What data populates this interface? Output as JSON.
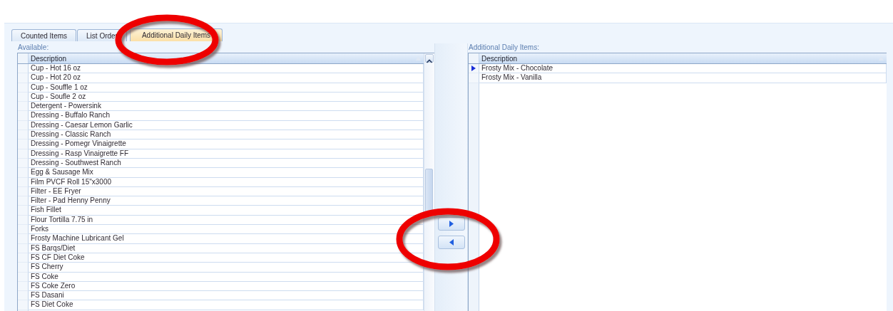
{
  "tabs": [
    {
      "label": "Counted Items",
      "selected": false
    },
    {
      "label": "List Order",
      "selected": false
    },
    {
      "label": "Additional Daily Items",
      "selected": true
    }
  ],
  "available": {
    "label": "Available:",
    "column": "Description",
    "scrollbar": true,
    "rows": [
      {
        "description": "Cup - Hot 16 oz",
        "current": false
      },
      {
        "description": "Cup - Hot 20 oz",
        "current": false
      },
      {
        "description": "Cup - Souffle 1 oz",
        "current": false
      },
      {
        "description": "Cup - Soufle 2 oz",
        "current": false
      },
      {
        "description": "Detergent - Powersink",
        "current": false
      },
      {
        "description": "Dressing - Buffalo Ranch",
        "current": false
      },
      {
        "description": "Dressing - Caesar Lemon Garlic",
        "current": false
      },
      {
        "description": "Dressing - Classic Ranch",
        "current": false
      },
      {
        "description": "Dressing - Pomegr Vinaigrette",
        "current": false
      },
      {
        "description": "Dressing - Rasp Vinaigrette FF",
        "current": false
      },
      {
        "description": "Dressing - Southwest Ranch",
        "current": false
      },
      {
        "description": "Egg & Sausage Mix",
        "current": false
      },
      {
        "description": "Film PVCF Roll 15\"x3000",
        "current": false
      },
      {
        "description": "Filter - EE Fryer",
        "current": false
      },
      {
        "description": "Filter - Pad Henny Penny",
        "current": false
      },
      {
        "description": "Fish Fillet",
        "current": false
      },
      {
        "description": "Flour Tortilla 7.75 in",
        "current": false
      },
      {
        "description": "Forks",
        "current": false
      },
      {
        "description": "Frosty Machine Lubricant Gel",
        "current": false
      },
      {
        "description": "FS Barqs/Diet",
        "current": false
      },
      {
        "description": "FS CF Diet Coke",
        "current": false
      },
      {
        "description": "FS Cherry",
        "current": false
      },
      {
        "description": "FS Coke",
        "current": false
      },
      {
        "description": "FS Coke Zero",
        "current": false
      },
      {
        "description": "FS Dasani",
        "current": false
      },
      {
        "description": "FS Diet Coke",
        "current": false
      }
    ]
  },
  "buttons": [
    {
      "kind": "add"
    },
    {
      "kind": "remove"
    }
  ],
  "additional": {
    "label": "Additional Daily Items:",
    "column": "Description",
    "scrollbar": false,
    "rows": [
      {
        "description": "Frosty Mix - Chocolate",
        "current": true
      },
      {
        "description": "Frosty Mix - Vanilla",
        "current": false
      }
    ]
  },
  "annotations": [
    {
      "kind": "ellipse"
    },
    {
      "kind": "ellipse"
    }
  ]
}
